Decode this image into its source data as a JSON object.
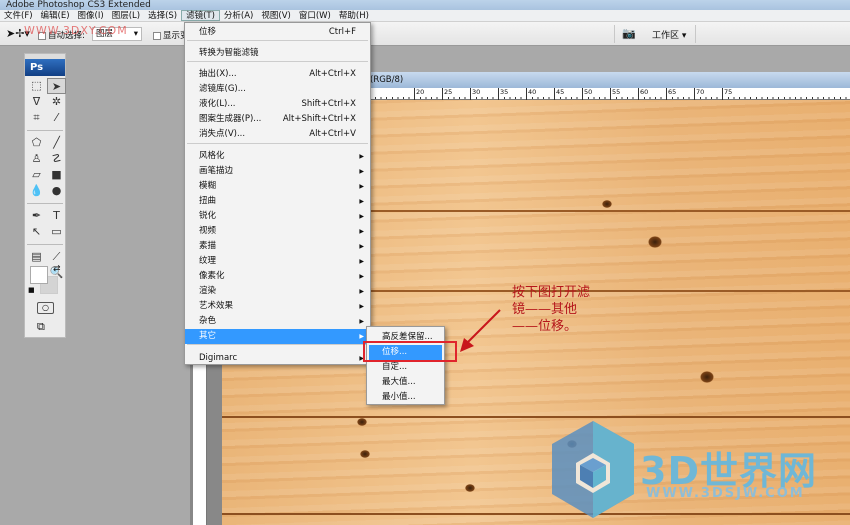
{
  "app": {
    "title": "Adobe Photoshop CS3 Extended"
  },
  "menubar": [
    "文件(F)",
    "编辑(E)",
    "图像(I)",
    "图层(L)",
    "选择(S)",
    "滤镜(T)",
    "分析(A)",
    "视图(V)",
    "窗口(W)",
    "帮助(H)"
  ],
  "options": {
    "watermark": "WWW.3DXY.COM",
    "auto_select_label": "自动选择:",
    "auto_select_value": "图层",
    "show_label": "显示变",
    "workspace": "工作区 ▾"
  },
  "toolbox": {
    "logo": "Ps"
  },
  "document": {
    "title": "(RGB/8)",
    "ruler_ticks": [
      "20",
      "25",
      "30",
      "35",
      "40",
      "45",
      "50",
      "55",
      "60",
      "65",
      "70",
      "75"
    ]
  },
  "filter_menu": {
    "items": [
      {
        "label": "位移",
        "shortcut": "Ctrl+F"
      },
      {
        "label": "转换为智能滤镜"
      },
      {
        "label": "抽出(X)...",
        "shortcut": "Alt+Ctrl+X"
      },
      {
        "label": "滤镜库(G)..."
      },
      {
        "label": "液化(L)...",
        "shortcut": "Shift+Ctrl+X"
      },
      {
        "label": "图案生成器(P)...",
        "shortcut": "Alt+Shift+Ctrl+X"
      },
      {
        "label": "消失点(V)...",
        "shortcut": "Alt+Ctrl+V"
      },
      {
        "label": "风格化",
        "submenu": true
      },
      {
        "label": "画笔描边",
        "submenu": true
      },
      {
        "label": "模糊",
        "submenu": true
      },
      {
        "label": "扭曲",
        "submenu": true
      },
      {
        "label": "锐化",
        "submenu": true
      },
      {
        "label": "视频",
        "submenu": true
      },
      {
        "label": "素描",
        "submenu": true
      },
      {
        "label": "纹理",
        "submenu": true
      },
      {
        "label": "像素化",
        "submenu": true
      },
      {
        "label": "渲染",
        "submenu": true
      },
      {
        "label": "艺术效果",
        "submenu": true
      },
      {
        "label": "杂色",
        "submenu": true
      },
      {
        "label": "其它",
        "submenu": true,
        "highlighted": true
      },
      {
        "label": "Digimarc",
        "submenu": true
      }
    ]
  },
  "other_submenu": {
    "items": [
      "高反差保留...",
      "位移...",
      "自定...",
      "最大值...",
      "最小值..."
    ],
    "highlighted": "位移..."
  },
  "annotation": {
    "text": "按下图打开滤\n镜——其他\n——位移。",
    "color": "#b5161b"
  },
  "logo": {
    "name": "3D世界网",
    "url": "WWW.3DSJW.COM"
  },
  "colors": {
    "highlight": "#3399ff",
    "red_box": "#e0242c"
  }
}
